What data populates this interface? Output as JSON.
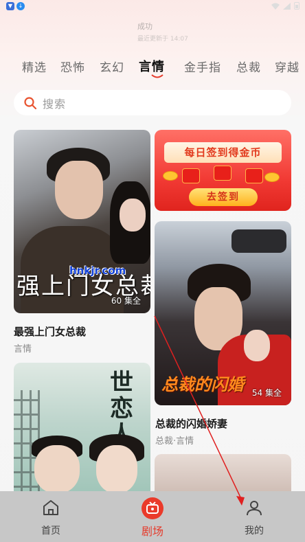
{
  "status_bar": {
    "time": "",
    "app_icon": "app-store-icon",
    "download_icon": "download-icon"
  },
  "toast": {
    "title": "成功",
    "subtitle": "最近更新于 14:07"
  },
  "tabs": [
    {
      "label": "精选",
      "active": false
    },
    {
      "label": "恐怖",
      "active": false
    },
    {
      "label": "玄幻",
      "active": false
    },
    {
      "label": "言情",
      "active": true
    },
    {
      "label": "金手指",
      "active": false
    },
    {
      "label": "总裁",
      "active": false
    },
    {
      "label": "穿越",
      "active": false
    }
  ],
  "search": {
    "placeholder": "搜索"
  },
  "dramas": [
    {
      "poster_text": "强上门女总裁",
      "episodes": "60 集全",
      "title": "最强上门女总裁",
      "genre": "言情"
    },
    {
      "poster_text": "总裁的闪婚",
      "episodes": "54 集全",
      "title": "总裁的闪婚娇妻",
      "genre": "总裁·言情"
    },
    {
      "poster_text": "世恋人"
    }
  ],
  "banner": {
    "headline": "每日签到得金币",
    "button": "去签到"
  },
  "watermark": "hnkjr.com",
  "bottom_nav": [
    {
      "label": "首页",
      "icon": "home-icon",
      "active": false
    },
    {
      "label": "剧场",
      "icon": "theater-icon",
      "active": true
    },
    {
      "label": "我的",
      "icon": "user-icon",
      "active": false
    }
  ],
  "colors": {
    "accent": "#e53b2c",
    "nav_bg": "#c7c7c7",
    "annotation_arrow": "#e02020"
  }
}
